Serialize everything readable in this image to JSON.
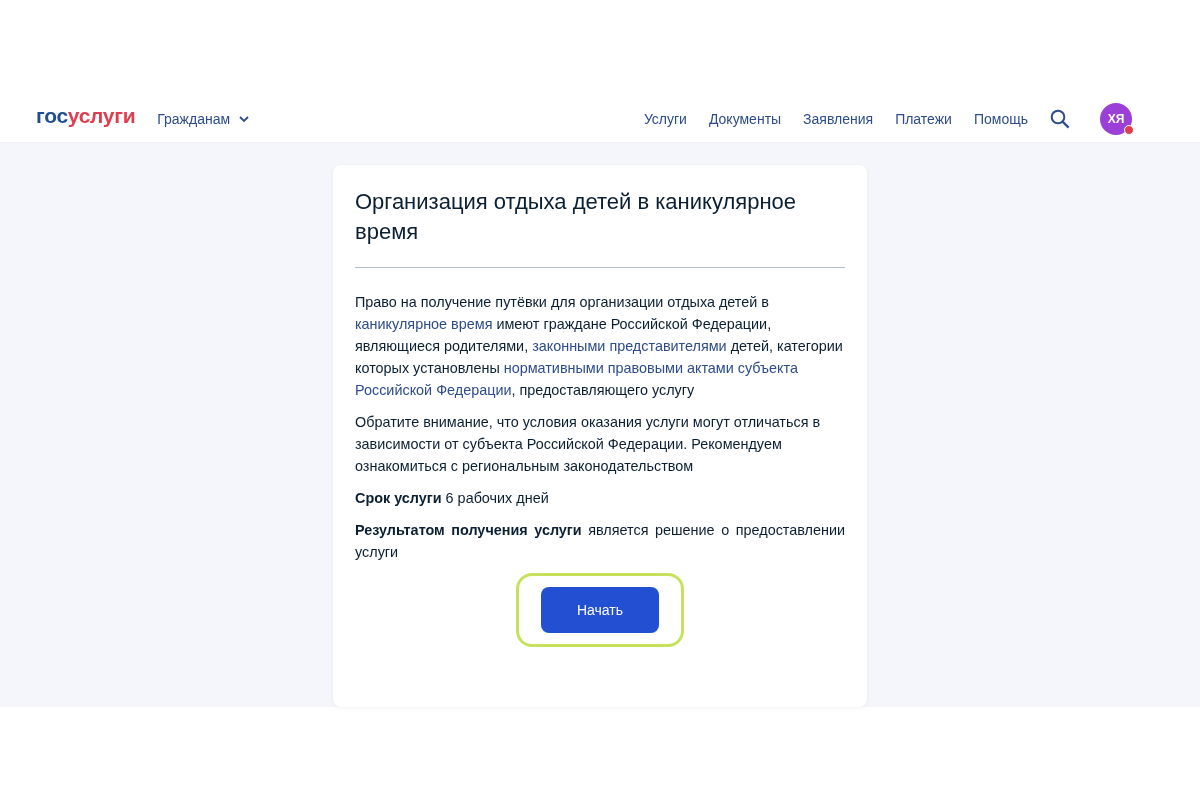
{
  "header": {
    "logo": [
      "гос",
      "услуги"
    ],
    "audience_menu": "Гражданам",
    "nav": [
      "Услуги",
      "Документы",
      "Заявления",
      "Платежи",
      "Помощь"
    ],
    "avatar": {
      "initials": "ХЯ",
      "has_notification": true
    }
  },
  "card": {
    "title": "Организация отдыха детей в каникулярное время",
    "paragraphs": [
      {
        "kind": "segments",
        "segments": [
          {
            "kind": "text",
            "text": "Право на получение путёвки для организации отдыха детей в "
          },
          {
            "kind": "link",
            "text": "каникулярное время"
          },
          {
            "kind": "text",
            "text": " имеют граждане Российской Федерации, являющиеся родителями, "
          },
          {
            "kind": "link",
            "text": "законными представителями"
          },
          {
            "kind": "text",
            "text": " детей, категории которых установлены "
          },
          {
            "kind": "link",
            "text": "нормативными правовыми актами субъекта"
          },
          {
            "kind": "link",
            "text": "Российской Федерации"
          },
          {
            "kind": "text",
            "text": ", предоставляющего услугу"
          }
        ]
      },
      {
        "kind": "plain",
        "text": "Обратите внимание, что условия оказания услуги могут отличаться в зависимости от субъекта Российской Федерации. Рекомендуем ознакомиться с региональным законодательством"
      },
      {
        "kind": "plain",
        "text": "**Срок услуги** 6 рабочих дней"
      },
      {
        "kind": "justified",
        "text": "**Результатом получения услуги** является решение о предоставлении услуги"
      }
    ],
    "start_button": {
      "label": "Начать",
      "highlighted": true
    }
  }
}
